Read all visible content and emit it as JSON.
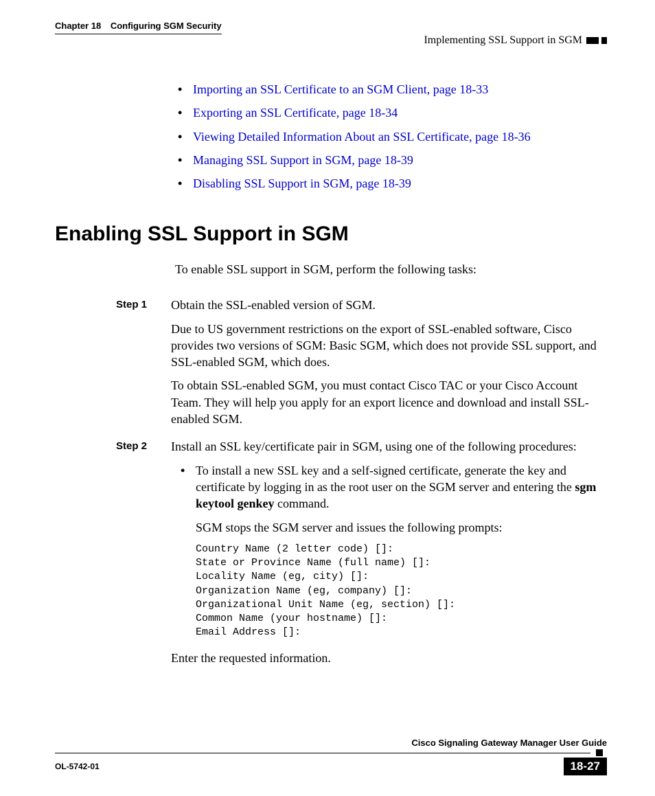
{
  "header": {
    "chapter_label": "Chapter 18",
    "chapter_title": "Configuring SGM Security",
    "section_title": "Implementing SSL Support in SGM"
  },
  "top_bullets": [
    "Importing an SSL Certificate to an SGM Client, page 18-33",
    "Exporting an SSL Certificate, page 18-34",
    "Viewing Detailed Information About an SSL Certificate, page 18-36",
    "Managing SSL Support in SGM, page 18-39",
    "Disabling SSL Support in SGM, page 18-39"
  ],
  "section_heading": "Enabling SSL Support in SGM",
  "intro_text": "To enable SSL support in SGM, perform the following tasks:",
  "steps": {
    "step1": {
      "label": "Step 1",
      "p1": "Obtain the SSL-enabled version of SGM.",
      "p2": "Due to US government restrictions on the export of SSL-enabled software, Cisco provides two versions of SGM: Basic SGM, which does not provide SSL support, and SSL-enabled SGM, which does.",
      "p3": "To obtain SSL-enabled SGM, you must contact Cisco TAC or your Cisco Account Team. They will help you apply for an export licence and download and install SSL-enabled SGM."
    },
    "step2": {
      "label": "Step 2",
      "p1": "Install an SSL key/certificate pair in SGM, using one of the following procedures:",
      "bullet_pre": "To install a new SSL key and a self-signed certificate, generate the key and certificate by logging in as the root user on the SGM server and entering the ",
      "bullet_cmd": "sgm keytool genkey",
      "bullet_post": " command.",
      "p2": "SGM stops the SGM server and issues the following prompts:",
      "code": "Country Name (2 letter code) []:\nState or Province Name (full name) []:\nLocality Name (eg, city) []:\nOrganization Name (eg, company) []:\nOrganizational Unit Name (eg, section) []:\nCommon Name (your hostname) []:\nEmail Address []:",
      "p3": "Enter the requested information."
    }
  },
  "footer": {
    "guide_title": "Cisco Signaling Gateway Manager User Guide",
    "doc_id": "OL-5742-01",
    "page_number": "18-27"
  }
}
